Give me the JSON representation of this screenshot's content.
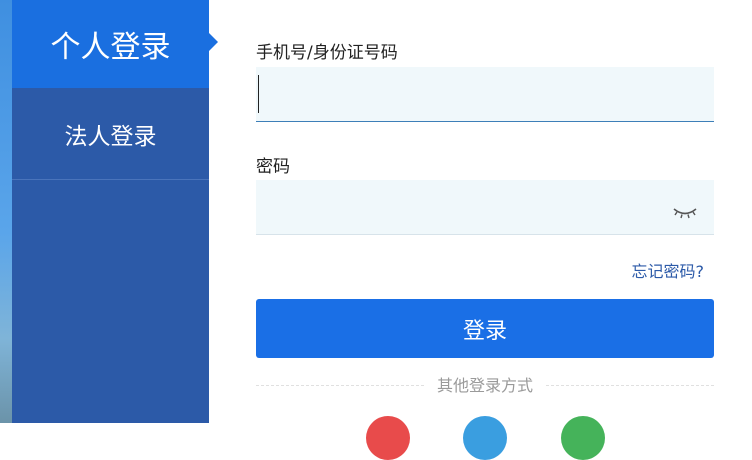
{
  "tabs": {
    "personal": "个人登录",
    "corporate": "法人登录"
  },
  "form": {
    "phone_label": "手机号/身份证号码",
    "phone_value": "",
    "password_label": "密码",
    "password_value": "",
    "forgot_link": "忘记密码?",
    "login_button": "登录",
    "other_methods": "其他登录方式"
  },
  "colors": {
    "sidebar": "#2c5aa8",
    "active_tab": "#1a6fe0",
    "primary_button": "#1a6fe6",
    "input_bg": "#f0f8fb"
  },
  "icons": {
    "password_toggle": "eye-closed-icon",
    "social": [
      "red-circle-icon",
      "blue-circle-icon",
      "green-circle-icon"
    ]
  }
}
